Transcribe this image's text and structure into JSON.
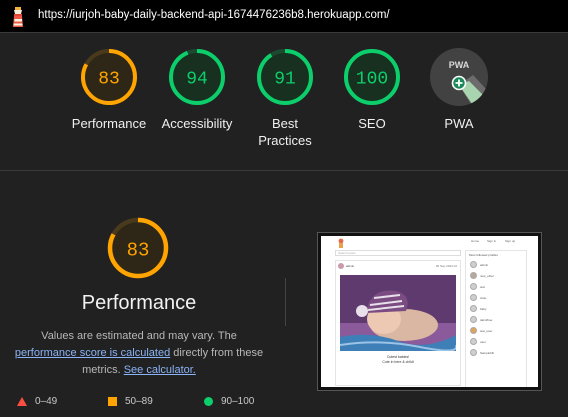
{
  "header": {
    "url": "https://iurjoh-baby-daily-backend-api-1674476236b8.herokuapp.com/"
  },
  "gauges": [
    {
      "label": "Performance",
      "score": "83",
      "value": 83,
      "color": "#ffa400",
      "track": "#4a3a1c",
      "fill": "#2e2616"
    },
    {
      "label": "Accessibility",
      "score": "94",
      "value": 94,
      "color": "#0cce6b",
      "track": "#1b4a31",
      "fill": "#17301f"
    },
    {
      "label": "Best Practices",
      "score": "91",
      "value": 91,
      "color": "#0cce6b",
      "track": "#1b4a31",
      "fill": "#17301f"
    },
    {
      "label": "SEO",
      "score": "100",
      "value": 100,
      "color": "#0cce6b",
      "track": "#1b4a31",
      "fill": "#17301f"
    },
    {
      "label": "PWA",
      "badge": "PWA"
    }
  ],
  "performance": {
    "score": "83",
    "value": 83,
    "title": "Performance",
    "desc_1": "Values are estimated and may vary. The",
    "link_score": "performance score is calculated",
    "desc_2": " directly from these metrics. ",
    "link_calc": "See calculator."
  },
  "legend": [
    {
      "range": "0–49",
      "shape": "triangle",
      "color": "#ff4e42"
    },
    {
      "range": "50–89",
      "shape": "square",
      "color": "#ffa400"
    },
    {
      "range": "90–100",
      "shape": "circle",
      "color": "#0cce6b"
    }
  ],
  "screenshot": {
    "nav_home": "Home",
    "nav_signin": "Sign in",
    "nav_signup": "Sign up",
    "search_placeholder": "Search posts",
    "post_author": "admin",
    "post_date": "06 Sep 2023 02",
    "caption_title": "Cutest babies!",
    "caption_sub": "Cute in here & childl",
    "sidebar_title": "Most followed profiles",
    "profiles": [
      "admin",
      "new_other",
      "test",
      "cutie",
      "baby",
      "daimfhoe",
      "test_user",
      "user",
      "Samplehill"
    ]
  }
}
